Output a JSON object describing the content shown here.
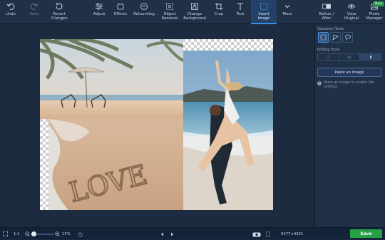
{
  "toolbar": {
    "undo": "Undo",
    "redo": "Redo",
    "revert": "Revert\nChanges",
    "adjust": "Adjust",
    "effects": "Effects",
    "retouching": "Retouching",
    "object_removal": "Object\nRemoval",
    "change_background": "Change\nBackground",
    "crop": "Crop",
    "text": "Text",
    "insert_image": "Insert\nImage",
    "more": "More",
    "before_after": "Before /\nAfter",
    "view_original": "View\nOriginal",
    "photo_manager": "Photo\nManager",
    "new_badge": "New"
  },
  "panel": {
    "selection_tools_label": "Selection Tools",
    "editing_tools_label": "Editing Tools",
    "paste_button": "Paste an Image",
    "hint": "Paste an image to enable the settings."
  },
  "status": {
    "ratio": "1:1",
    "zoom": "15%",
    "dimensions": "5477×4021",
    "save": "Save"
  },
  "photo": {
    "caption_written": "LOVE"
  }
}
